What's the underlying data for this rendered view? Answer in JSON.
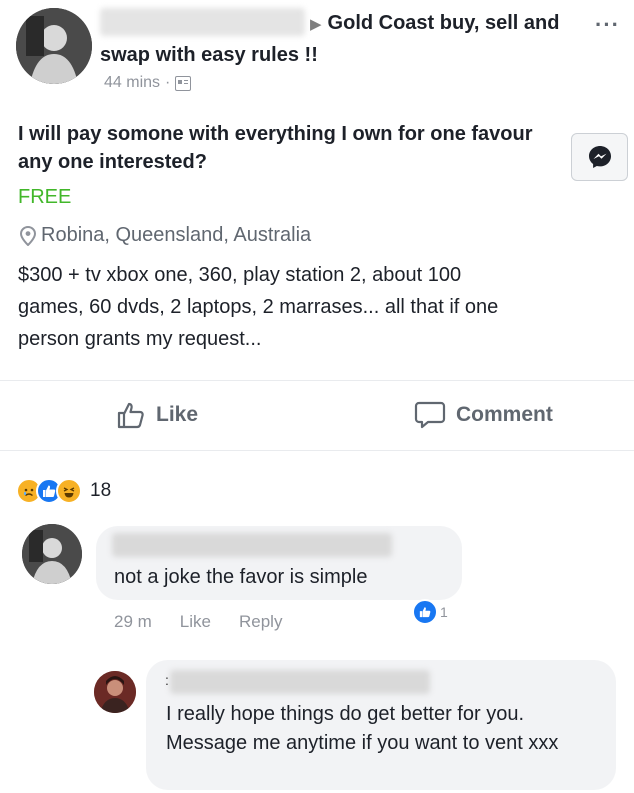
{
  "post": {
    "group_arrow": "▶",
    "group_name": "Gold Coast buy, sell and swap with easy rules !!",
    "more": "···",
    "time": "44 mins",
    "separator": "·",
    "title": "I will pay somone with everything I own for one favour any one interested?",
    "price": "FREE",
    "location": "Robina, Queensland, Australia",
    "description_lines": [
      "$300 + tv xbox one, 360, play station 2, about 100",
      "games, 60 dvds, 2 laptops, 2 marrases... all that if one",
      "person grants my request..."
    ]
  },
  "actions": {
    "like_label": "Like",
    "comment_label": "Comment"
  },
  "reactions": {
    "icons": [
      "sad",
      "like",
      "haha"
    ],
    "count": "18"
  },
  "comments": [
    {
      "text": "not a joke the favor is simple",
      "time": "29 m",
      "like_label": "Like",
      "reply_label": "Reply",
      "like_count": "1"
    }
  ],
  "reply": {
    "mark": ":",
    "text": "I really hope things do get better for you. Message me anytime if you want to vent xxx"
  },
  "colors": {
    "price": "#42b72a",
    "like_blue": "#1877f2",
    "muted": "#90949c"
  }
}
